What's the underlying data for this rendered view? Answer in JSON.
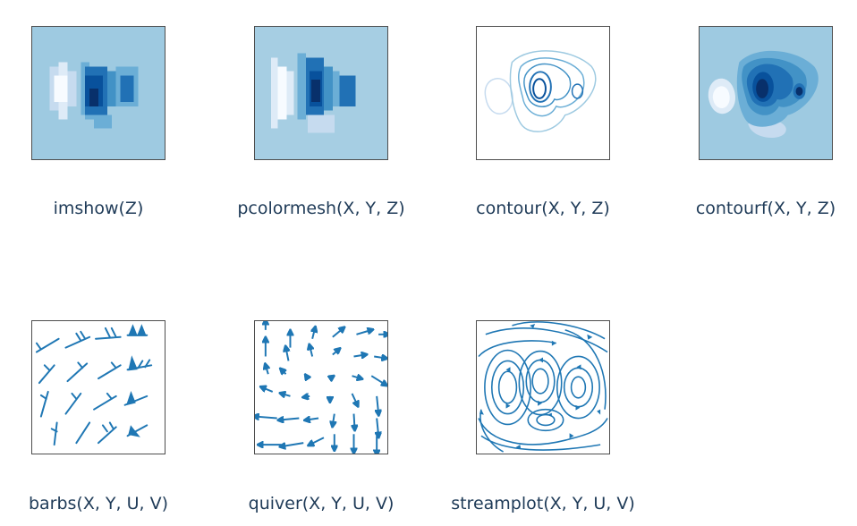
{
  "colors": {
    "caption_text": "#1f3b58",
    "vector_blue": "#1f77b4",
    "frame": "#4d4d4d"
  },
  "gallery": [
    {
      "caption": "imshow(Z)",
      "icon": "imshow-heatmap-icon"
    },
    {
      "caption": "pcolormesh(X, Y, Z)",
      "icon": "pcolormesh-heatmap-icon"
    },
    {
      "caption": "contour(X, Y, Z)",
      "icon": "contour-lines-icon"
    },
    {
      "caption": "contourf(X, Y, Z)",
      "icon": "contourf-filled-icon"
    },
    {
      "caption": "barbs(X, Y, U, V)",
      "icon": "barbs-wind-icon"
    },
    {
      "caption": "quiver(X, Y, U, V)",
      "icon": "quiver-arrows-icon"
    },
    {
      "caption": "streamplot(X, Y, U, V)",
      "icon": "streamplot-flow-icon"
    }
  ]
}
